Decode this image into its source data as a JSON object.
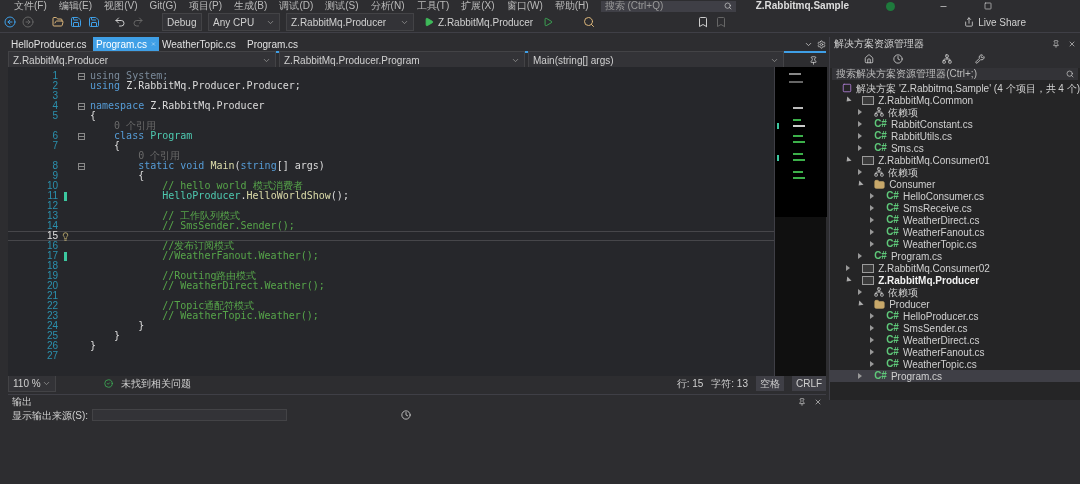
{
  "menu": [
    "文件(F)",
    "编辑(E)",
    "视图(V)",
    "Git(G)",
    "项目(P)",
    "生成(B)",
    "调试(D)",
    "测试(S)",
    "分析(N)",
    "工具(T)",
    "扩展(X)",
    "窗口(W)",
    "帮助(H)"
  ],
  "search": {
    "placeholder": "搜索 (Ctrl+Q)"
  },
  "window": {
    "title": "Z.Rabbitmq.Sample"
  },
  "toolbar": {
    "configuration": "Debug",
    "platform": "Any CPU",
    "startup_project": "Z.RabbitMq.Producer",
    "run_button": "Z.RabbitMq.Producer",
    "live_share": "Live Share"
  },
  "tabs": [
    {
      "label": "HelloProducer.cs",
      "selected": false
    },
    {
      "label": "Program.cs",
      "selected": true
    },
    {
      "label": "WeatherTopic.cs",
      "selected": false
    },
    {
      "label": "Program.cs",
      "selected": false
    }
  ],
  "navigation": [
    "Z.RabbitMq.Producer",
    "Z.RabbitMq.Producer.Program",
    "Main(string[] args)"
  ],
  "code": [
    {
      "n": "1",
      "fold": true,
      "modified": false,
      "current": false,
      "tokens": [
        {
          "text": "using System;",
          "kind": "unused"
        }
      ]
    },
    {
      "n": "2",
      "fold": false,
      "modified": false,
      "current": false,
      "tokens": [
        {
          "text": "using",
          "kind": "keyword"
        },
        {
          "text": " Z.RabbitMq.Producer.Producer;",
          "kind": "plain"
        }
      ]
    },
    {
      "n": "3",
      "fold": false,
      "modified": false,
      "current": false
    },
    {
      "n": "4",
      "fold": true,
      "modified": false,
      "current": false,
      "tokens": [
        {
          "text": "namespace",
          "kind": "keyword"
        },
        {
          "text": " Z.RabbitMq.Producer",
          "kind": "plain"
        }
      ]
    },
    {
      "n": "5",
      "fold": false,
      "modified": false,
      "current": false,
      "tokens": [
        {
          "text": "{",
          "kind": "plain"
        }
      ]
    },
    {
      "lens": "    0 个引用"
    },
    {
      "n": "6",
      "fold": true,
      "modified": false,
      "current": false,
      "tokens": [
        {
          "text": "    class",
          "kind": "keyword"
        },
        {
          "text": " Program",
          "kind": "type"
        }
      ]
    },
    {
      "n": "7",
      "fold": false,
      "modified": false,
      "current": false,
      "tokens": [
        {
          "text": "    {",
          "kind": "plain"
        }
      ]
    },
    {
      "lens": "        0 个引用"
    },
    {
      "n": "8",
      "fold": true,
      "modified": false,
      "current": false,
      "tokens": [
        {
          "text": "        static void",
          "kind": "keyword"
        },
        {
          "text": " Main",
          "kind": "method"
        },
        {
          "text": "(",
          "kind": "plain"
        },
        {
          "text": "string",
          "kind": "keyword"
        },
        {
          "text": "[] args)",
          "kind": "plain"
        }
      ]
    },
    {
      "n": "9",
      "fold": false,
      "modified": false,
      "current": false,
      "tokens": [
        {
          "text": "        {",
          "kind": "plain"
        }
      ]
    },
    {
      "n": "10",
      "fold": false,
      "modified": false,
      "current": false,
      "tokens": [
        {
          "text": "            // hello world 模式消费者",
          "kind": "comment"
        }
      ]
    },
    {
      "n": "11",
      "fold": false,
      "modified": true,
      "current": false,
      "tokens": [
        {
          "text": "            HelloProducer",
          "kind": "type"
        },
        {
          "text": ".",
          "kind": "plain"
        },
        {
          "text": "HelloWorldShow",
          "kind": "method"
        },
        {
          "text": "();",
          "kind": "plain"
        }
      ]
    },
    {
      "n": "12",
      "fold": false,
      "modified": false,
      "current": false
    },
    {
      "n": "13",
      "fold": false,
      "modified": false,
      "current": false,
      "tokens": [
        {
          "text": "            // 工作队列模式",
          "kind": "comment"
        }
      ]
    },
    {
      "n": "14",
      "fold": false,
      "modified": false,
      "current": false,
      "tokens": [
        {
          "text": "            // SmsSender.Sender();",
          "kind": "comment"
        }
      ]
    },
    {
      "n": "15",
      "fold": false,
      "modified": false,
      "current": true
    },
    {
      "n": "16",
      "fold": false,
      "modified": false,
      "current": false,
      "tokens": [
        {
          "text": "            //发布订阅模式",
          "kind": "comment"
        }
      ]
    },
    {
      "n": "17",
      "fold": false,
      "modified": true,
      "current": false,
      "tokens": [
        {
          "text": "            //WeatherFanout.Weather();",
          "kind": "comment"
        }
      ]
    },
    {
      "n": "18",
      "fold": false,
      "modified": false,
      "current": false
    },
    {
      "n": "19",
      "fold": false,
      "modified": false,
      "current": false,
      "tokens": [
        {
          "text": "            //Routing路由模式",
          "kind": "comment"
        }
      ]
    },
    {
      "n": "20",
      "fold": false,
      "modified": false,
      "current": false,
      "tokens": [
        {
          "text": "            // WeatherDirect.Weather();",
          "kind": "comment"
        }
      ]
    },
    {
      "n": "21",
      "fold": false,
      "modified": false,
      "current": false
    },
    {
      "n": "22",
      "fold": false,
      "modified": false,
      "current": false,
      "tokens": [
        {
          "text": "            //Topic通配符模式",
          "kind": "comment"
        }
      ]
    },
    {
      "n": "23",
      "fold": false,
      "modified": false,
      "current": false,
      "tokens": [
        {
          "text": "            // WeatherTopic.Weather();",
          "kind": "comment"
        }
      ]
    },
    {
      "n": "24",
      "fold": false,
      "modified": false,
      "current": false,
      "tokens": [
        {
          "text": "        }",
          "kind": "plain"
        }
      ]
    },
    {
      "n": "25",
      "fold": false,
      "modified": false,
      "current": false,
      "tokens": [
        {
          "text": "    }",
          "kind": "plain"
        }
      ]
    },
    {
      "n": "26",
      "fold": false,
      "modified": false,
      "current": false,
      "tokens": [
        {
          "text": "}",
          "kind": "plain"
        }
      ]
    },
    {
      "n": "27",
      "fold": false,
      "modified": false,
      "current": false
    }
  ],
  "status_bar": {
    "zoom": "110 %",
    "issues": "未找到相关问题",
    "line": "行: 15",
    "column": "字符: 13",
    "whitespace": "空格",
    "line_ending": "CRLF"
  },
  "output": {
    "title": "输出",
    "source_label": "显示输出来源(S):"
  },
  "solution_explorer": {
    "title": "解决方案资源管理器",
    "search": {
      "placeholder": "搜索解决方案资源管理器(Ctrl+;)"
    },
    "tree": [
      {
        "label": "解决方案 'Z.Rabbitmq.Sample' (4 个项目，共 4 个)",
        "kind": "solution",
        "bold": false,
        "selected": false,
        "children": [
          {
            "label": "Z.RabbitMq.Common",
            "kind": "project",
            "expanded": true,
            "bold": false,
            "selected": false,
            "children": [
              {
                "label": "依赖项",
                "kind": "deps",
                "expanded": false,
                "bold": false,
                "selected": false
              },
              {
                "label": "RabbitConstant.cs",
                "kind": "cs",
                "icon": "C#",
                "expanded": false,
                "bold": false,
                "selected": false
              },
              {
                "label": "RabbitUtils.cs",
                "kind": "cs",
                "icon": "C#",
                "expanded": false,
                "bold": false,
                "selected": false
              },
              {
                "label": "Sms.cs",
                "kind": "cs",
                "icon": "C#",
                "expanded": false,
                "bold": false,
                "selected": false
              }
            ]
          },
          {
            "label": "Z.RabbitMq.Consumer01",
            "kind": "project",
            "expanded": true,
            "bold": false,
            "selected": false,
            "children": [
              {
                "label": "依赖项",
                "kind": "deps",
                "expanded": false,
                "bold": false,
                "selected": false
              },
              {
                "label": "Consumer",
                "kind": "folder",
                "expanded": true,
                "bold": false,
                "selected": false,
                "children": [
                  {
                    "label": "HelloConsumer.cs",
                    "kind": "cs",
                    "icon": "C#",
                    "expanded": false,
                    "bold": false,
                    "selected": false
                  },
                  {
                    "label": "SmsReceive.cs",
                    "kind": "cs",
                    "icon": "C#",
                    "expanded": false,
                    "bold": false,
                    "selected": false
                  },
                  {
                    "label": "WeatherDirect.cs",
                    "kind": "cs",
                    "icon": "C#",
                    "expanded": false,
                    "bold": false,
                    "selected": false
                  },
                  {
                    "label": "WeatherFanout.cs",
                    "kind": "cs",
                    "icon": "C#",
                    "expanded": false,
                    "bold": false,
                    "selected": false
                  },
                  {
                    "label": "WeatherTopic.cs",
                    "kind": "cs",
                    "icon": "C#",
                    "expanded": false,
                    "bold": false,
                    "selected": false
                  }
                ]
              },
              {
                "label": "Program.cs",
                "kind": "cs",
                "icon": "C#",
                "expanded": false,
                "bold": false,
                "selected": false
              }
            ]
          },
          {
            "label": "Z.RabbitMq.Consumer02",
            "kind": "project",
            "expanded": false,
            "bold": false,
            "selected": false
          },
          {
            "label": "Z.RabbitMq.Producer",
            "kind": "project",
            "expanded": true,
            "bold": true,
            "selected": false,
            "children": [
              {
                "label": "依赖项",
                "kind": "deps",
                "expanded": false,
                "bold": false,
                "selected": false
              },
              {
                "label": "Producer",
                "kind": "folder",
                "expanded": true,
                "bold": false,
                "selected": false,
                "children": [
                  {
                    "label": "HelloProducer.cs",
                    "kind": "cs",
                    "icon": "C#",
                    "expanded": false,
                    "bold": false,
                    "selected": false
                  },
                  {
                    "label": "SmsSender.cs",
                    "kind": "cs",
                    "icon": "C#",
                    "expanded": false,
                    "bold": false,
                    "selected": false
                  },
                  {
                    "label": "WeatherDirect.cs",
                    "kind": "cs",
                    "icon": "C#",
                    "expanded": false,
                    "bold": false,
                    "selected": false
                  },
                  {
                    "label": "WeatherFanout.cs",
                    "kind": "cs",
                    "icon": "C#",
                    "expanded": false,
                    "bold": false,
                    "selected": false
                  },
                  {
                    "label": "WeatherTopic.cs",
                    "kind": "cs",
                    "icon": "C#",
                    "expanded": false,
                    "bold": false,
                    "selected": false
                  }
                ]
              },
              {
                "label": "Program.cs",
                "kind": "cs",
                "icon": "C#",
                "expanded": false,
                "bold": false,
                "selected": true
              }
            ]
          }
        ]
      }
    ]
  }
}
